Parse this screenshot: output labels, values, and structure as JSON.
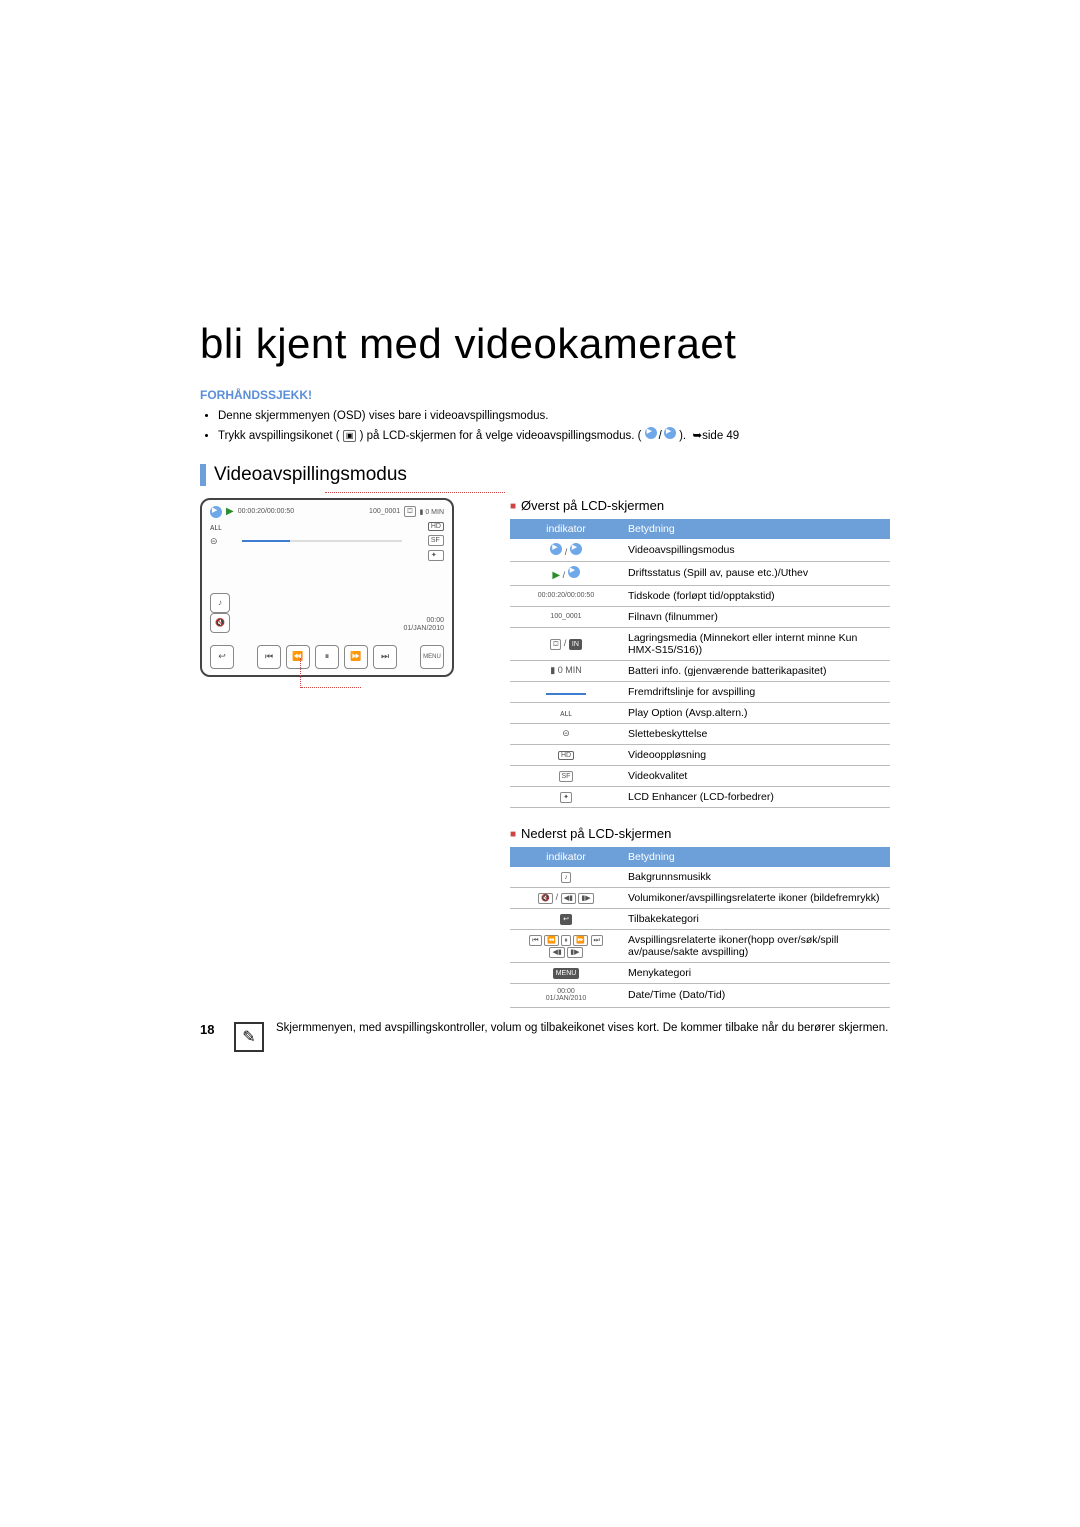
{
  "page_number": "18",
  "title": "bli kjent med videokameraet",
  "precheck_label": "FORHÅNDSSJEKK!",
  "bullets": [
    "Denne skjermmenyen (OSD) vises bare i videoavspillingsmodus.",
    "Trykk avspillingsikonet (  ) på LCD-skjermen for å velge videoavspillingsmodus. (  /  ).  ➥side 49"
  ],
  "section_heading": "Videoavspillingsmodus",
  "lcd": {
    "timecode": "00:00:20/00:00:50",
    "filename": "100_0001",
    "battery": "0 MIN",
    "time": "00:00",
    "date": "01/JAN/2010"
  },
  "top_table": {
    "caption": "Øverst på LCD-skjermen",
    "headers": [
      "indikator",
      "Betydning"
    ],
    "rows": [
      {
        "ind": "mode",
        "text": "Videoavspillingsmodus"
      },
      {
        "ind": "play",
        "text": "Driftsstatus (Spill av, pause etc.)/Uthev"
      },
      {
        "ind": "tc",
        "text": "Tidskode (forløpt tid/opptakstid)"
      },
      {
        "ind": "fn",
        "text": "Filnavn (filnummer)"
      },
      {
        "ind": "media",
        "text": "Lagringsmedia (Minnekort eller internt minne Kun HMX-S15/S16))"
      },
      {
        "ind": "batt",
        "text": "Batteri info. (gjenværende batterikapasitet)"
      },
      {
        "ind": "prog",
        "text": "Fremdriftslinje for avspilling"
      },
      {
        "ind": "playopt",
        "text": "Play Option (Avsp.altern.)"
      },
      {
        "ind": "lock",
        "text": "Slettebeskyttelse"
      },
      {
        "ind": "hd",
        "text": "Videooppløsning"
      },
      {
        "ind": "vq",
        "text": "Videokvalitet"
      },
      {
        "ind": "lcd",
        "text": "LCD Enhancer (LCD-forbedrer)"
      }
    ]
  },
  "bottom_table": {
    "caption": "Nederst på LCD-skjermen",
    "headers": [
      "indikator",
      "Betydning"
    ],
    "rows": [
      {
        "ind": "music",
        "text": "Bakgrunnsmusikk"
      },
      {
        "ind": "vol",
        "text": "Volumikoner/avspillingsrelaterte ikoner (bildefremrykk)"
      },
      {
        "ind": "back",
        "text": "Tilbakekategori"
      },
      {
        "ind": "ctrl",
        "text": "Avspillingsrelaterte ikoner(hopp over/søk/spill av/pause/sakte avspilling)"
      },
      {
        "ind": "menu",
        "text": "Menykategori"
      },
      {
        "ind": "dt",
        "text": "Date/Time (Dato/Tid)"
      }
    ]
  },
  "note_text": "Skjermmenyen, med avspillingskontroller, volum og tilbakeikonet vises kort. De kommer tilbake når du berører skjermen.",
  "icons": {
    "tc_small": "00:00:20/00:00:50",
    "fn_small": "100_0001",
    "batt_small": "0 MIN",
    "date_small": "00:00",
    "date_small2": "01/JAN/2010",
    "menu": "MENU"
  }
}
